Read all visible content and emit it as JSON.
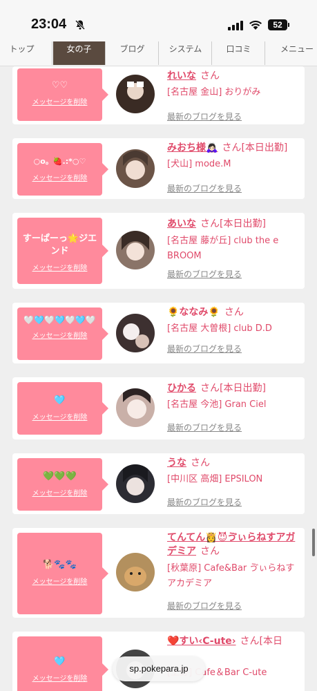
{
  "status": {
    "time": "23:04",
    "battery": "52"
  },
  "tabs": [
    "トップ",
    "女の子",
    "ブログ",
    "システム",
    "口コミ",
    "メニュー"
  ],
  "delete_label": "メッセージを削除",
  "san_label": "さん",
  "blog_label": "最新のブログを見る",
  "url": "sp.pokepara.jp",
  "cards": [
    {
      "message": "♡♡",
      "name": "れいな",
      "tag": "",
      "shop": "[名古屋 金山] おりがみ",
      "avatar_color": "#3a2b24"
    },
    {
      "message": "○o。🍓.:*○♡",
      "name": "みおち様🙇🏻‍♀️",
      "tag": "[本日出勤]",
      "shop": "[犬山] mode.M",
      "avatar_color": "#6b5447"
    },
    {
      "message": "すーぱーっ🌟ジエンド",
      "name": "あいな",
      "tag": "[本日出勤]",
      "shop": "[名古屋 藤が丘] club the e BROOM",
      "avatar_color": "#8a7468"
    },
    {
      "message": "🤍🩵🤍🩵🤍🩵🤍",
      "name": "🌻ななみ🌻",
      "tag": "",
      "shop": "[名古屋 大曽根] club D.D",
      "avatar_color": "#3d3030"
    },
    {
      "message": "🩵",
      "name": "ひかる",
      "tag": "[本日出勤]",
      "shop": "[名古屋 今池] Gran Ciel",
      "avatar_color": "#c9b0a8"
    },
    {
      "message": "💚💚💚",
      "name": "うな",
      "tag": "",
      "shop": "[中川区 高畑] EPSILON",
      "avatar_color": "#2c2c33"
    },
    {
      "message": "🐕🐾🐾",
      "name": "てんてん👸😈ゔぃらねすアガデミア",
      "tag": "",
      "shop": "[秋葉原] Cafe&Bar ゔぃらねすアカデミア",
      "avatar_color": "#b3905e"
    },
    {
      "message": "🩵",
      "name": "❤️すい‹C-ute›",
      "tag": "[本日",
      "shop": "[上野] Cafe＆Bar C-ute",
      "avatar_color": "#444"
    }
  ]
}
